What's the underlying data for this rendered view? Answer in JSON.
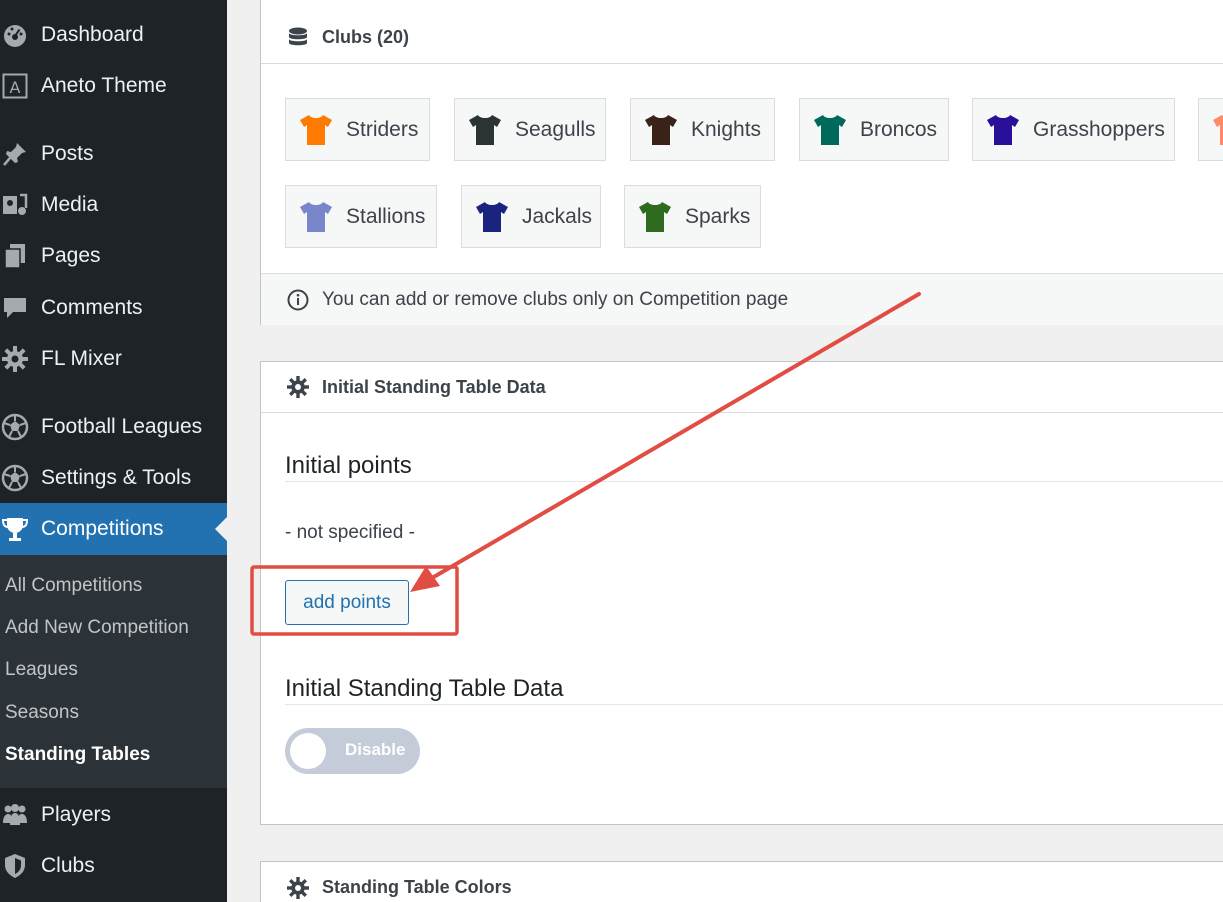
{
  "sidebar": {
    "items": [
      {
        "label": "Dashboard",
        "icon": "dashboard-icon"
      },
      {
        "label": "Aneto Theme",
        "icon": "theme-a-icon"
      },
      {
        "label": "Posts",
        "icon": "pushpin-icon"
      },
      {
        "label": "Media",
        "icon": "media-icon"
      },
      {
        "label": "Pages",
        "icon": "pages-icon"
      },
      {
        "label": "Comments",
        "icon": "comment-icon"
      },
      {
        "label": "FL Mixer",
        "icon": "gear-icon"
      },
      {
        "label": "Football Leagues",
        "icon": "soccer-ball-icon"
      },
      {
        "label": "Settings & Tools",
        "icon": "soccer-ball-icon"
      },
      {
        "label": "Competitions",
        "icon": "trophy-icon"
      },
      {
        "label": "Players",
        "icon": "players-icon"
      },
      {
        "label": "Clubs",
        "icon": "shield-icon"
      }
    ],
    "submenu": [
      "All Competitions",
      "Add New Competition",
      "Leagues",
      "Seasons",
      "Standing Tables"
    ],
    "accent": "#2271b1"
  },
  "clubs_panel": {
    "title": "Clubs (20)",
    "clubs": [
      {
        "name": "Striders",
        "color": "#ff7a00"
      },
      {
        "name": "Seagulls",
        "color": "#2c3335"
      },
      {
        "name": "Knights",
        "color": "#3a2218"
      },
      {
        "name": "Broncos",
        "color": "#00695c"
      },
      {
        "name": "Grasshoppers",
        "color": "#2a0f9a"
      },
      {
        "name": "",
        "color": "#ff8a65"
      },
      {
        "name": "Stallions",
        "color": "#7986cb"
      },
      {
        "name": "Jackals",
        "color": "#1a237e"
      },
      {
        "name": "Sparks",
        "color": "#2e6b1e"
      }
    ],
    "notice": "You can add or remove clubs only on Competition page"
  },
  "initial_panel": {
    "title": "Initial Standing Table Data",
    "points_heading": "Initial points",
    "points_value": "- not specified -",
    "add_button": "add points",
    "table_heading": "Initial Standing Table Data",
    "toggle_label": "Disable"
  },
  "colors_panel": {
    "title": "Standing Table Colors"
  },
  "annotation_color": "#e14d43"
}
